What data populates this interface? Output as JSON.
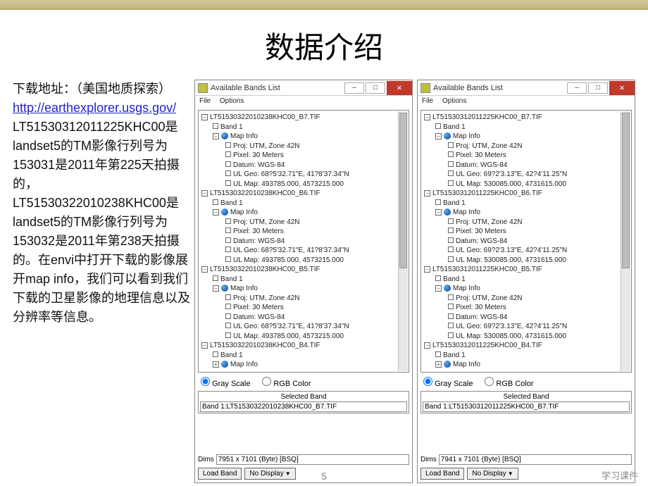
{
  "page_title": "数据介绍",
  "left_text": {
    "line1": "下载地址：（美国地质探索）",
    "url": "http://earthexplorer.usgs.gov/",
    "body": "LT51530312011225KHC00是landset5的TM影像行列号为153031是2011年第225天拍摄的，LT51530322010238KHC00是landset5的TM影像行列号为153032是2011年第238天拍摄的。在envi中打开下载的影像展开map info，我们可以看到我们下载的卫星影像的地理信息以及分辨率等信息。"
  },
  "page_number": "5",
  "footer_right": "学习课件",
  "window_common": {
    "title": "Available Bands List",
    "menu_file": "File",
    "menu_options": "Options",
    "gray_scale": "Gray Scale",
    "rgb_color": "RGB Color",
    "selected_band_label": "Selected Band",
    "dims_label": "Dims",
    "load_band": "Load Band",
    "no_display": "No Display",
    "band1": "Band 1",
    "map_info": "Map Info",
    "pixel": "Pixel: 30 Meters",
    "datum": "Datum: WGS-84"
  },
  "panel_left": {
    "f1": "LT51530322010238KHC00_B7.TIF",
    "f2": "LT51530322010238KHC00_B6.TIF",
    "f3": "LT51530322010238KHC00_B5.TIF",
    "f4": "LT51530322010238KHC00_B4.TIF",
    "proj": "Proj: UTM, Zone 42N",
    "ulgeo": "UL Geo: 68?5'32.71\"E, 41?8'37.34\"N",
    "ulmap": "UL Map: 493785.000, 4573215.000",
    "selected": "Band 1:LT51530322010238KHC00_B7.TIF",
    "dims": "7951 x 7101 (Byte) [BSQ]"
  },
  "panel_right": {
    "f1": "LT51530312011225KHC00_B7.TIF",
    "f2": "LT51530312011225KHC00_B6.TIF",
    "f3": "LT51530312011225KHC00_B5.TIF",
    "f4": "LT51530312011225KHC00_B4.TIF",
    "proj": "Proj: UTM, Zone 42N",
    "ulgeo": "UL Geo: 69?2'3.13\"E, 42?4'11.25\"N",
    "ulmap": "UL Map: 530085.000, 4731615.000",
    "selected": "Band 1:LT51530312011225KHC00_B7.TIF",
    "dims": "7941 x 7101 (Byte) [BSQ]"
  }
}
